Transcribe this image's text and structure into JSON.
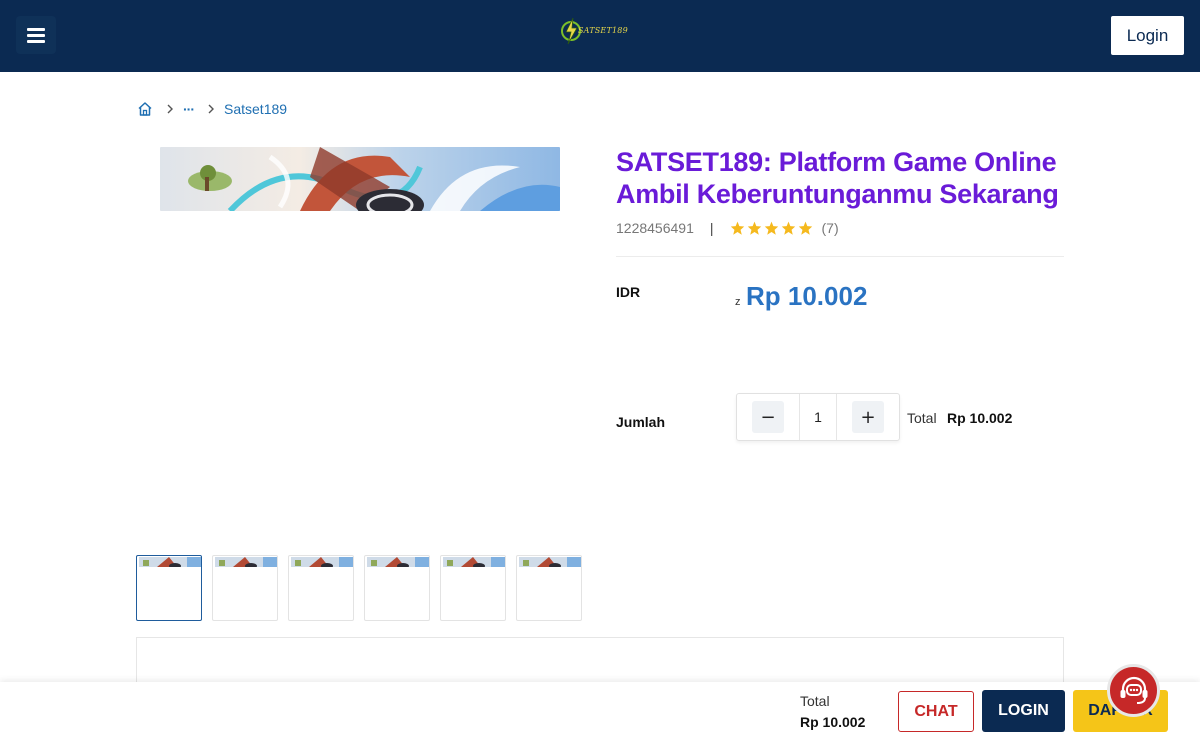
{
  "header": {
    "logo_text": "SATSET189",
    "login_label": "Login",
    "menu_icon": "hamburger-icon"
  },
  "breadcrumb": {
    "home_icon": "home-icon",
    "ellipsis": "···",
    "current": "Satset189"
  },
  "product": {
    "title": "SATSET189: Platform Game Online Ambil Keberuntunganmu Sekarang",
    "sku": "1228456491",
    "separator": "|",
    "rating_stars": 5,
    "review_count": "(7)",
    "currency_label": "IDR",
    "price_prefix": "z",
    "price": "Rp 10.002",
    "quantity_label": "Jumlah",
    "quantity_value": "1",
    "decrement_symbol": "−",
    "increment_symbol": "+",
    "total_label": "Total",
    "total_value": "Rp 10.002",
    "thumbnail_count": 6,
    "active_thumbnail": 1
  },
  "bottom_bar": {
    "total_label": "Total",
    "total_value": "Rp 10.002",
    "chat_label": "CHAT",
    "login_label": "LOGIN",
    "daftar_label": "DAFTAR"
  },
  "colors": {
    "header_bg": "#0b2a52",
    "title": "#6a1bd8",
    "price": "#2a73c2",
    "chat": "#c62828",
    "daftar": "#f5c518",
    "star": "#f5b91e"
  }
}
